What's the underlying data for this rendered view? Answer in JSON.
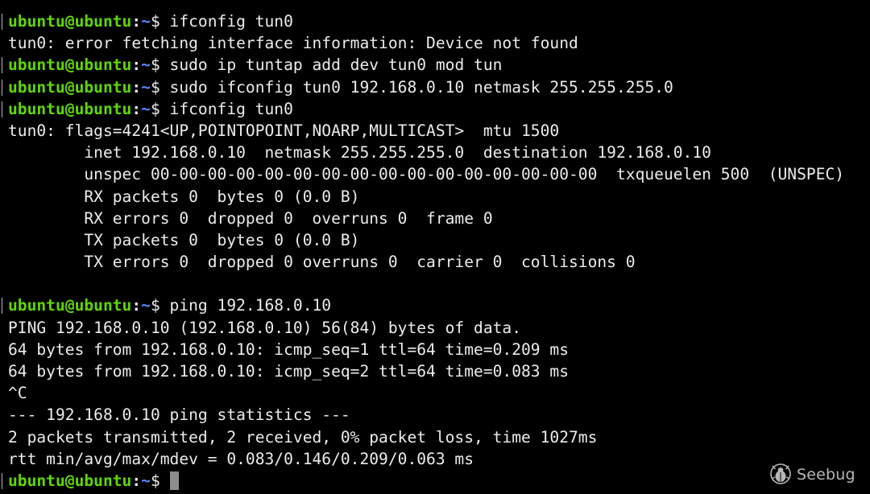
{
  "prompt": {
    "user": "ubuntu@ubuntu",
    "path": "~",
    "symbol": "$"
  },
  "lines": [
    {
      "type": "prompt",
      "command": "ifconfig tun0"
    },
    {
      "type": "output",
      "text": "tun0: error fetching interface information: Device not found"
    },
    {
      "type": "prompt",
      "command": "sudo ip tuntap add dev tun0 mod tun"
    },
    {
      "type": "prompt",
      "command": "sudo ifconfig tun0 192.168.0.10 netmask 255.255.255.0"
    },
    {
      "type": "prompt",
      "command": "ifconfig tun0"
    },
    {
      "type": "output",
      "text": "tun0: flags=4241<UP,POINTOPOINT,NOARP,MULTICAST>  mtu 1500"
    },
    {
      "type": "output",
      "text": "        inet 192.168.0.10  netmask 255.255.255.0  destination 192.168.0.10"
    },
    {
      "type": "output",
      "text": "        unspec 00-00-00-00-00-00-00-00-00-00-00-00-00-00-00-00  txqueuelen 500  (UNSPEC)"
    },
    {
      "type": "output",
      "text": "        RX packets 0  bytes 0 (0.0 B)"
    },
    {
      "type": "output",
      "text": "        RX errors 0  dropped 0  overruns 0  frame 0"
    },
    {
      "type": "output",
      "text": "        TX packets 0  bytes 0 (0.0 B)"
    },
    {
      "type": "output",
      "text": "        TX errors 0  dropped 0 overruns 0  carrier 0  collisions 0"
    },
    {
      "type": "output",
      "text": ""
    },
    {
      "type": "prompt",
      "command": "ping 192.168.0.10"
    },
    {
      "type": "output",
      "text": "PING 192.168.0.10 (192.168.0.10) 56(84) bytes of data."
    },
    {
      "type": "output",
      "text": "64 bytes from 192.168.0.10: icmp_seq=1 ttl=64 time=0.209 ms"
    },
    {
      "type": "output",
      "text": "64 bytes from 192.168.0.10: icmp_seq=2 ttl=64 time=0.083 ms"
    },
    {
      "type": "output",
      "text": "^C"
    },
    {
      "type": "output",
      "text": "--- 192.168.0.10 ping statistics ---"
    },
    {
      "type": "output",
      "text": "2 packets transmitted, 2 received, 0% packet loss, time 1027ms"
    },
    {
      "type": "output",
      "text": "rtt min/avg/max/mdev = 0.083/0.146/0.209/0.063 ms"
    },
    {
      "type": "prompt",
      "command": "",
      "cursor": true
    }
  ],
  "watermark": {
    "text": "Seebug",
    "icon": "seebug-logo-icon"
  },
  "colors": {
    "background": "#000000",
    "text": "#ececec",
    "prompt_user": "#5fd700",
    "prompt_path": "#5f87ff",
    "cursor": "#8d8d8d"
  }
}
